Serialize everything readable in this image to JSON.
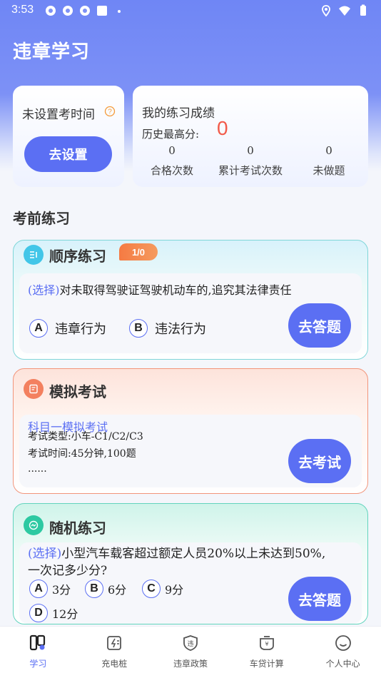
{
  "status_bar": {
    "time": "3:53"
  },
  "header": {
    "title": "违章学习"
  },
  "exam_time_card": {
    "text": "未设置考时间",
    "button_label": "去设置"
  },
  "score_card": {
    "title": "我的练习成绩",
    "best_label": "历史最高分:",
    "best_value": "0",
    "stats": [
      {
        "value": "0",
        "label": "合格次数"
      },
      {
        "value": "0",
        "label": "累计考试次数"
      },
      {
        "value": "0",
        "label": "未做题"
      }
    ]
  },
  "section_title": "考前练习",
  "sequential": {
    "title": "顺序练习",
    "progress": "1/0",
    "question_tag": "(选择)",
    "question": "对未取得驾驶证驾驶机动车的,追究其法律责任",
    "options": [
      {
        "letter": "A",
        "text": "违章行为"
      },
      {
        "letter": "B",
        "text": "违法行为"
      }
    ],
    "button_label": "去答题"
  },
  "mock": {
    "title": "模拟考试",
    "subject": "科目一模拟考试",
    "line1": "考试类型:小车-C1/C2/C3",
    "line2": "考试时间:45分钟,100题",
    "line3": "......",
    "button_label": "去考试"
  },
  "random": {
    "title": "随机练习",
    "question_tag": "(选择)",
    "question_line1": "小型汽车载客超过额定人员20%以上未达到50%,",
    "question_line2": "一次记多少分?",
    "options": [
      {
        "letter": "A",
        "text": "3分"
      },
      {
        "letter": "B",
        "text": "6分"
      },
      {
        "letter": "C",
        "text": "9分"
      },
      {
        "letter": "D",
        "text": "12分"
      }
    ],
    "button_label": "去答题"
  },
  "tabs": [
    {
      "label": "学习",
      "icon": "study-icon",
      "active": true
    },
    {
      "label": "充电桩",
      "icon": "charging-pile-icon",
      "active": false
    },
    {
      "label": "违章政策",
      "icon": "policy-shield-icon",
      "active": false
    },
    {
      "label": "车贷计算",
      "icon": "loan-calculator-icon",
      "active": false
    },
    {
      "label": "个人中心",
      "icon": "profile-icon",
      "active": false
    }
  ],
  "colors": {
    "accent": "#5b6ff3",
    "score_red": "#f25a4a",
    "badge_orange": "#f57a43"
  }
}
